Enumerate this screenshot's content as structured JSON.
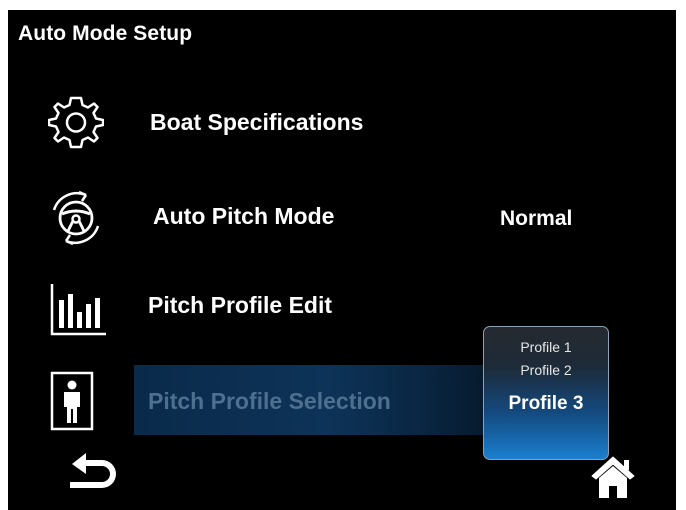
{
  "screen": {
    "title": "Auto Mode Setup"
  },
  "menu": {
    "items": [
      {
        "label": "Boat Specifications",
        "icon": "gear-icon"
      },
      {
        "label": "Auto Pitch Mode",
        "icon": "steering-wheel-icon",
        "value": "Normal"
      },
      {
        "label": "Pitch Profile Edit",
        "icon": "bar-chart-icon"
      },
      {
        "label": "Pitch Profile Selection",
        "icon": "person-icon",
        "selected": true
      }
    ]
  },
  "profile_dropdown": {
    "options": [
      "Profile 1",
      "Profile 2",
      "Profile 3"
    ],
    "selected": "Profile 3"
  },
  "nav": {
    "back_icon": "back-arrow-icon",
    "home_icon": "home-icon"
  },
  "colors": {
    "background": "#000000",
    "highlight": "#0d3358",
    "popup_accent": "#1a7fcf"
  }
}
